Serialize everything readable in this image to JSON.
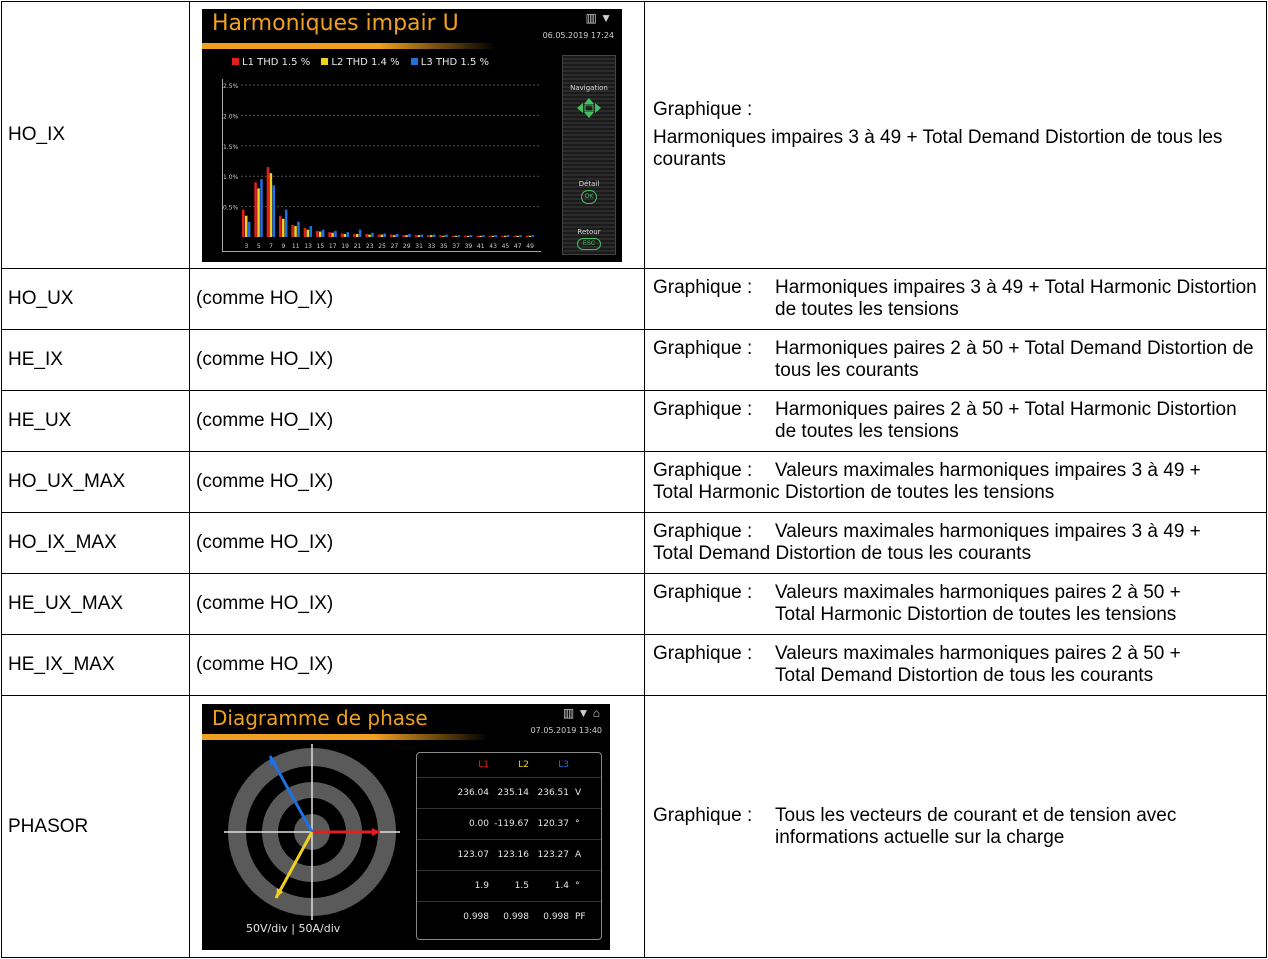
{
  "rows": [
    {
      "code": "HO_IX",
      "col2_text": "",
      "desc_lines": [
        "Graphique :",
        "Harmoniques impaires 3 à 49 + Total Demand Distortion de tous les courants"
      ]
    },
    {
      "code": "HO_UX",
      "col2_text": "(comme HO_IX)",
      "label": "Graphique :",
      "desc": "Harmoniques impaires 3 à 49 + Total Harmonic Distortion de toutes les tensions"
    },
    {
      "code": "HE_IX",
      "col2_text": "(comme HO_IX)",
      "label": "Graphique :",
      "desc": "Harmoniques paires 2 à 50 + Total Demand Distortion de tous les courants"
    },
    {
      "code": "HE_UX",
      "col2_text": "(comme HO_IX)",
      "label": "Graphique :",
      "desc": "Harmoniques paires 2 à 50 + Total Harmonic Distortion de toutes les tensions"
    },
    {
      "code": "HO_UX_MAX",
      "col2_text": "(comme HO_IX)",
      "label": "Graphique :",
      "desc_a": "Valeurs maximales harmoniques impaires 3 à 49 +",
      "desc_b": "Total Harmonic Distortion de toutes les tensions"
    },
    {
      "code": "HO_IX_MAX",
      "col2_text": "(comme HO_IX)",
      "label": "Graphique :",
      "desc_a": "Valeurs maximales harmoniques impaires 3 à 49 +",
      "desc_b": "Total Demand Distortion de tous les courants"
    },
    {
      "code": "HE_UX_MAX",
      "col2_text": "(comme HO_IX)",
      "label": "Graphique :",
      "desc_a": "Valeurs maximales harmoniques paires 2 à 50 +",
      "desc_b": "Total Harmonic Distortion de toutes les tensions"
    },
    {
      "code": "HE_IX_MAX",
      "col2_text": "(comme HO_IX)",
      "label": "Graphique :",
      "desc_a": "Valeurs maximales harmoniques paires 2 à 50 +",
      "desc_b": "Total Demand Distortion de tous les courants"
    },
    {
      "code": "PHASOR",
      "label": "Graphique :",
      "desc": "Tous les vecteurs de courant et de tension avec informations actuelle sur la charge"
    }
  ],
  "screen1": {
    "title": "Harmoniques impair U",
    "datetime": "06.05.2019 17:24",
    "legend": [
      {
        "label": "L1 THD 1.5 %",
        "color": "#e02020"
      },
      {
        "label": "L2 THD 1.4 %",
        "color": "#f0d020"
      },
      {
        "label": "L3 THD 1.5 %",
        "color": "#2070e0"
      }
    ],
    "side": {
      "navigation": "Navigation",
      "detail": "Détail",
      "detail_btn": "OK",
      "retour": "Retour",
      "retour_btn": "ESC"
    },
    "chart_data": {
      "type": "bar",
      "categories": [
        "3",
        "5",
        "7",
        "9",
        "11",
        "13",
        "15",
        "17",
        "19",
        "21",
        "23",
        "25",
        "27",
        "29",
        "31",
        "33",
        "35",
        "37",
        "39",
        "41",
        "43",
        "45",
        "47",
        "49"
      ],
      "series": [
        {
          "name": "L1",
          "values": [
            0.45,
            0.9,
            1.15,
            0.35,
            0.2,
            0.15,
            0.1,
            0.08,
            0.06,
            0.05,
            0.05,
            0.04,
            0.04,
            0.03,
            0.03,
            0.03,
            0.03,
            0.02,
            0.02,
            0.02,
            0.02,
            0.02,
            0.02,
            0.02
          ]
        },
        {
          "name": "L2",
          "values": [
            0.35,
            0.8,
            1.05,
            0.3,
            0.18,
            0.12,
            0.09,
            0.07,
            0.05,
            0.05,
            0.04,
            0.04,
            0.03,
            0.03,
            0.03,
            0.03,
            0.02,
            0.02,
            0.02,
            0.02,
            0.02,
            0.02,
            0.02,
            0.02
          ]
        },
        {
          "name": "L3",
          "values": [
            0.25,
            0.95,
            0.85,
            0.45,
            0.25,
            0.18,
            0.12,
            0.1,
            0.08,
            0.12,
            0.07,
            0.06,
            0.05,
            0.05,
            0.04,
            0.04,
            0.04,
            0.03,
            0.03,
            0.03,
            0.03,
            0.03,
            0.03,
            0.03
          ]
        }
      ],
      "ylim": [
        0,
        2.5
      ],
      "yticks": [
        "0.5%",
        "1.0%",
        "1.5%",
        "2.0%",
        "2.5%"
      ],
      "grid": true
    }
  },
  "screen2": {
    "title": "Diagramme de phase",
    "datetime": "07.05.2019 13:40",
    "headers": [
      "L1",
      "L2",
      "L3"
    ],
    "header_colors": [
      "#e02020",
      "#f0d020",
      "#2070e0"
    ],
    "table": [
      {
        "values": [
          "236.04",
          "235.14",
          "236.51"
        ],
        "unit": "V"
      },
      {
        "values": [
          "0.00",
          "-119.67",
          "120.37"
        ],
        "unit": "°"
      },
      {
        "values": [
          "123.07",
          "123.16",
          "123.27"
        ],
        "unit": "A"
      },
      {
        "values": [
          "1.9",
          "1.5",
          "1.4"
        ],
        "unit": "°"
      },
      {
        "values": [
          "0.998",
          "0.998",
          "0.998"
        ],
        "unit": "PF"
      }
    ],
    "scale_left": "50V/div",
    "scale_right": "50A/div"
  }
}
